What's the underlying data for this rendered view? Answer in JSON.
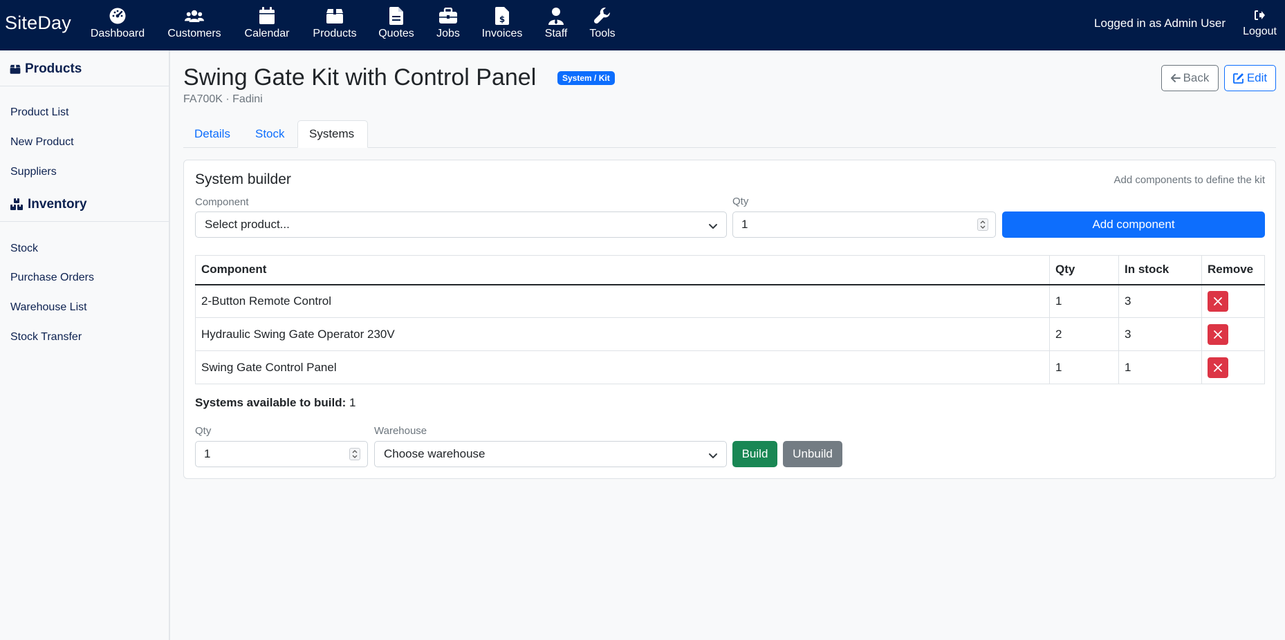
{
  "app": {
    "brand": "SiteDay"
  },
  "nav": {
    "items": [
      {
        "label": "Dashboard",
        "icon": "dashboard-gauge-icon"
      },
      {
        "label": "Customers",
        "icon": "users-icon"
      },
      {
        "label": "Calendar",
        "icon": "calendar-icon"
      },
      {
        "label": "Products",
        "icon": "box-icon"
      },
      {
        "label": "Quotes",
        "icon": "document-icon"
      },
      {
        "label": "Jobs",
        "icon": "briefcase-icon"
      },
      {
        "label": "Invoices",
        "icon": "invoice-dollar-icon"
      },
      {
        "label": "Staff",
        "icon": "user-tie-icon"
      },
      {
        "label": "Tools",
        "icon": "wrench-icon"
      }
    ],
    "logged_in": "Logged in as Admin User",
    "logout": "Logout"
  },
  "sidebar": {
    "products_heading": "Products",
    "products_links": [
      "Product List",
      "New Product",
      "Suppliers"
    ],
    "inventory_heading": "Inventory",
    "inventory_links": [
      "Stock",
      "Purchase Orders",
      "Warehouse List",
      "Stock Transfer"
    ]
  },
  "page": {
    "title": "Swing Gate Kit with Control Panel",
    "badge": "System / Kit",
    "subtitle": "FA700K · Fadini",
    "back": "Back",
    "edit": "Edit",
    "tabs": [
      "Details",
      "Stock",
      "Systems"
    ],
    "active_tab": "Systems"
  },
  "builder": {
    "title": "System builder",
    "hint": "Add components to define the kit",
    "component_label": "Component",
    "component_placeholder": "Select product...",
    "qty_label": "Qty",
    "qty_value": "1",
    "add_button": "Add component",
    "table": {
      "headers": [
        "Component",
        "Qty",
        "In stock",
        "Remove"
      ],
      "rows": [
        {
          "component": "2-Button Remote Control",
          "qty": "1",
          "in_stock": "3"
        },
        {
          "component": "Hydraulic Swing Gate Operator 230V",
          "qty": "2",
          "in_stock": "3"
        },
        {
          "component": "Swing Gate Control Panel",
          "qty": "1",
          "in_stock": "1"
        }
      ]
    },
    "available_label": "Systems available to build:",
    "available_value": "1",
    "build_qty_label": "Qty",
    "build_qty_value": "1",
    "warehouse_label": "Warehouse",
    "warehouse_placeholder": "Choose warehouse",
    "build_button": "Build",
    "unbuild_button": "Unbuild"
  },
  "colors": {
    "navbar": "#011b48",
    "primary": "#0d6efd",
    "danger": "#dc3545",
    "success": "#198754",
    "secondary": "#6c757d"
  }
}
